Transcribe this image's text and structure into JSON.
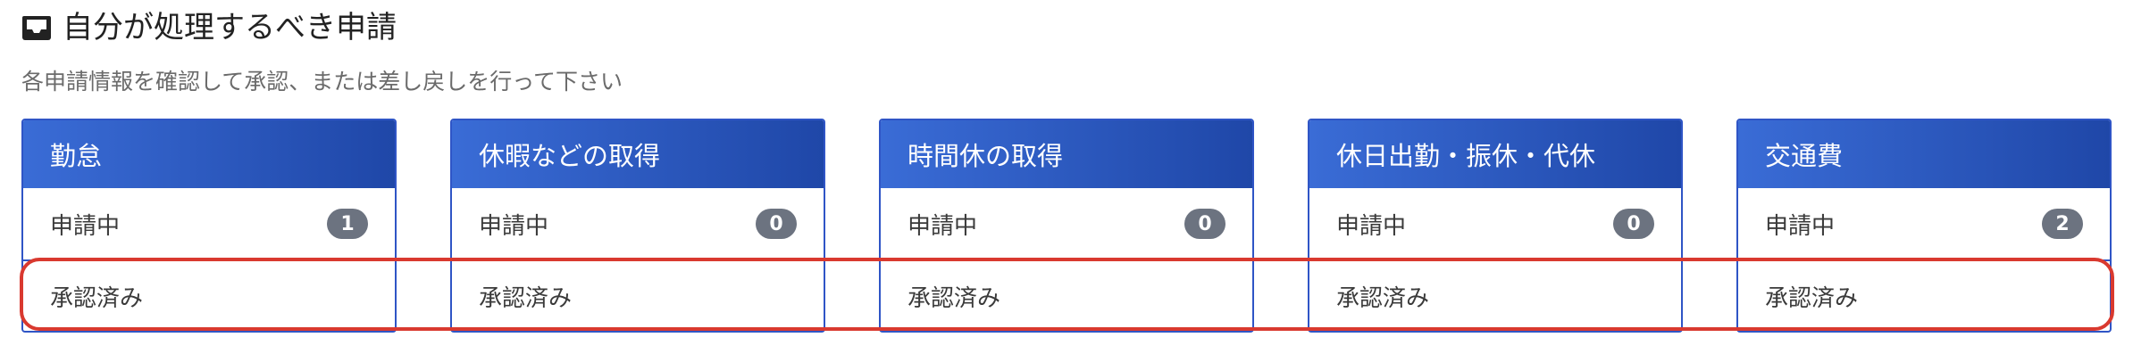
{
  "header": {
    "icon": "inbox-icon",
    "title": "自分が処理するべき申請",
    "subtitle": "各申請情報を確認して承認、または差し戻しを行って下さい"
  },
  "cards": [
    {
      "title": "勤怠",
      "pending_label": "申請中",
      "pending_count": "1",
      "approved_label": "承認済み"
    },
    {
      "title": "休暇などの取得",
      "pending_label": "申請中",
      "pending_count": "0",
      "approved_label": "承認済み"
    },
    {
      "title": "時間休の取得",
      "pending_label": "申請中",
      "pending_count": "0",
      "approved_label": "承認済み"
    },
    {
      "title": "休日出勤・振休・代休",
      "pending_label": "申請中",
      "pending_count": "0",
      "approved_label": "承認済み"
    },
    {
      "title": "交通費",
      "pending_label": "申請中",
      "pending_count": "2",
      "approved_label": "承認済み"
    }
  ],
  "colors": {
    "card_border": "#2f55c6",
    "header_gradient_start": "#3a6cd6",
    "header_gradient_end": "#1f47a8",
    "badge": "#6c7380",
    "highlight": "#d9392f"
  }
}
